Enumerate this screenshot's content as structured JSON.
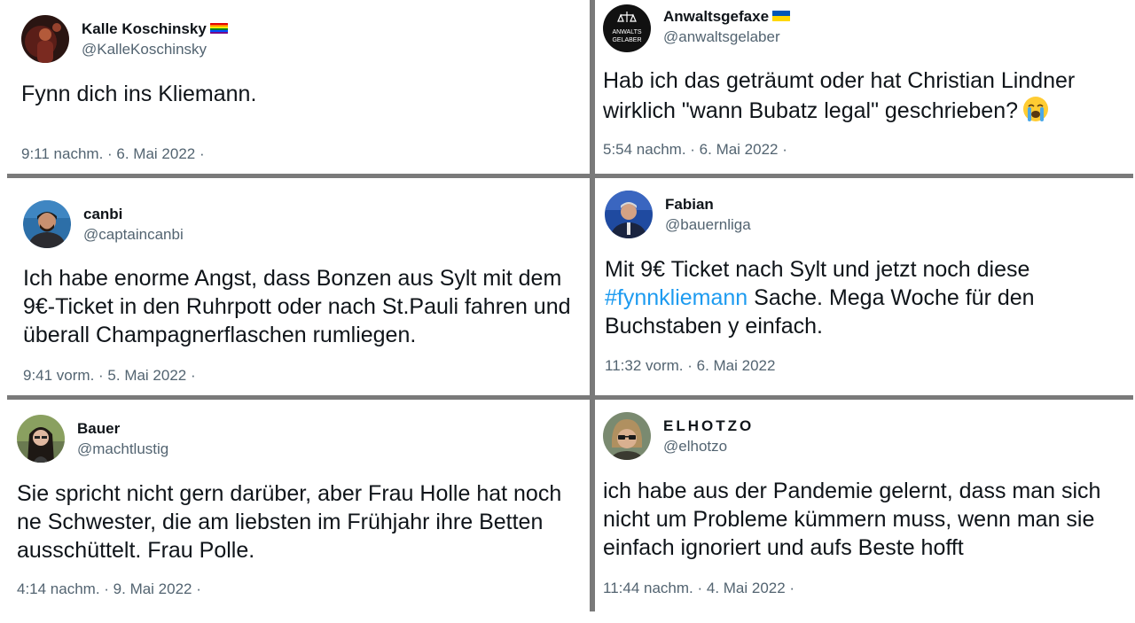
{
  "tweets": [
    {
      "name": "Kalle Koschinsky",
      "handle": "@KalleKoschinsky",
      "text": "Fynn dich ins Kliemann.",
      "meta": "9:11 nachm. · 6. Mai 2022 ·",
      "flag_icon": "rainbow-flag-icon"
    },
    {
      "name": "Anwaltsgefaxe",
      "handle": "@anwaltsgelaber",
      "avatar_text_top": "ANWALTS",
      "avatar_text_bottom": "GELABER",
      "text": "Hab ich das geträumt oder hat Christian Lindner wirklich \"wann Bubatz legal\" geschrieben?",
      "meta": "5:54 nachm. · 6. Mai 2022 ·",
      "flag_icon": "ukraine-flag-icon",
      "emoji_icon": "loudly-crying-face-icon"
    },
    {
      "name": "canbi",
      "handle": "@captaincanbi",
      "text": "Ich habe enorme Angst, dass Bonzen aus Sylt mit dem 9€-Ticket in den Ruhrpott oder nach St.Pauli fahren und überall Champagnerflaschen rumliegen.",
      "meta": "9:41 vorm. · 5. Mai 2022 ·"
    },
    {
      "name": "Fabian",
      "handle": "@bauernliga",
      "text_before": "Mit 9€ Ticket nach Sylt und jetzt noch diese",
      "hashtag": "#fynnkliemann",
      "text_after": "Sache. Mega Woche für den Buchstaben y einfach.",
      "meta": "11:32 vorm. · 6. Mai 2022"
    },
    {
      "name": "Bauer",
      "handle": "@machtlustig",
      "text": "Sie spricht nicht gern darüber, aber Frau Holle hat noch ne Schwester, die am liebsten im Frühjahr ihre Betten ausschüttelt. Frau Polle.",
      "meta": "4:14 nachm. · 9. Mai 2022 ·"
    },
    {
      "name": "ELHOTZO",
      "handle": "@elhotzo",
      "text": "ich habe aus der Pandemie gelernt, dass man sich nicht um Probleme kümmern muss, wenn man sie einfach ignoriert und aufs Beste hofft",
      "meta": "11:44 nachm. · 4. Mai 2022 ·"
    }
  ],
  "colors": {
    "text": "#0f1419",
    "secondary": "#536471",
    "hashtag": "#1d9bf0",
    "divider": "#7a7a7a"
  }
}
